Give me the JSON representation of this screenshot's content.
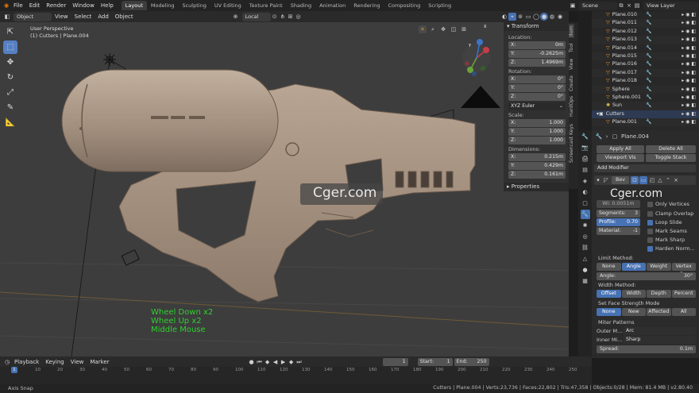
{
  "topbar": {
    "menus": [
      "File",
      "Edit",
      "Render",
      "Window",
      "Help"
    ],
    "workspaces": [
      "Layout",
      "Modeling",
      "Sculpting",
      "UV Editing",
      "Texture Paint",
      "Shading",
      "Animation",
      "Rendering",
      "Compositing",
      "Scripting"
    ],
    "active_workspace": "Layout",
    "scene": "Scene",
    "view_layer": "View Layer"
  },
  "viewport_header": {
    "mode": "Object Mode",
    "menus": [
      "View",
      "Select",
      "Add",
      "Object"
    ],
    "transform_orientation": "Local"
  },
  "viewport": {
    "perspective": "User Perspective",
    "object_info": "(1) Cutters | Plane.004",
    "watermark": "Cger.com",
    "screencast_keys": [
      "Wheel Down x2",
      "Wheel Up x2",
      "Middle Mouse"
    ],
    "gizmo": {
      "x": "X",
      "y": "Y",
      "z": "Z"
    }
  },
  "npanel": {
    "tabs": [
      "Item",
      "Tool",
      "View",
      "Create",
      "HardOps",
      "Screencast Keys"
    ],
    "transform": "Transform",
    "location": {
      "label": "Location:",
      "x": "0m",
      "y": "-0.2625m",
      "z": "1.4969m"
    },
    "rotation": {
      "label": "Rotation:",
      "x": "0°",
      "y": "0°",
      "z": "0°"
    },
    "rotation_mode": "XYZ Euler",
    "scale": {
      "label": "Scale:",
      "x": "1.000",
      "y": "1.000",
      "z": "1.000"
    },
    "dimensions": {
      "label": "Dimensions:",
      "x": "0.215m",
      "y": "0.429m",
      "z": "0.161m"
    },
    "properties": "Properties"
  },
  "outliner": {
    "rows": [
      {
        "name": "Plane.010"
      },
      {
        "name": "Plane.011"
      },
      {
        "name": "Plane.012"
      },
      {
        "name": "Plane.013"
      },
      {
        "name": "Plane.014"
      },
      {
        "name": "Plane.015"
      },
      {
        "name": "Plane.016"
      },
      {
        "name": "Plane.017"
      },
      {
        "name": "Plane.018"
      },
      {
        "name": "Sphere"
      },
      {
        "name": "Sphere.001"
      },
      {
        "name": "Sun"
      },
      {
        "name": "Cutters"
      },
      {
        "name": "Plane.001"
      }
    ]
  },
  "properties": {
    "object_name": "Plane.004",
    "apply_all": "Apply All",
    "delete_all": "Delete All",
    "viewport_vis": "Viewport Vis",
    "toggle_stack": "Toggle Stack",
    "add_modifier": "Add Modifier",
    "modifier_name": "Bev",
    "width_field": "Wi: 0.0051m",
    "only_vertices": "Only Vertices",
    "segments_label": "Segments:",
    "segments": "3",
    "clamp_overlap": "Clamp Overlap",
    "profile_label": "Profile:",
    "profile": "0.70",
    "loop_slide": "Loop Slide",
    "material_label": "Material:",
    "material": "-1",
    "mark_seams": "Mark Seams",
    "mark_sharp": "Mark Sharp",
    "harden_normals": "Harden Norm...",
    "limit_method": "Limit Method:",
    "limit_options": [
      "None",
      "Angle",
      "Weight",
      "Vertex G..."
    ],
    "limit_selected": "Angle",
    "angle_label": "Angle:",
    "angle": "30°",
    "width_method": "Width Method:",
    "width_options": [
      "Offset",
      "Width",
      "Depth",
      "Percent"
    ],
    "width_selected": "Offset",
    "face_strength": "Set Face Strength Mode",
    "face_options": [
      "None",
      "New",
      "Affected",
      "All"
    ],
    "face_selected": "None",
    "miter_patterns": "Miter Patterns",
    "outer_label": "Outer M...",
    "outer_value": "Arc",
    "inner_label": "Inner Mi...",
    "inner_value": "Sharp",
    "spread_label": "Spread:",
    "spread": "0.1m"
  },
  "timeline": {
    "menus": [
      "Playback",
      "Keying",
      "View",
      "Marker"
    ],
    "current_frame": "1",
    "start_label": "Start:",
    "start": "1",
    "end_label": "End:",
    "end": "250",
    "ticks": [
      "0",
      "10",
      "20",
      "30",
      "40",
      "50",
      "60",
      "70",
      "80",
      "90",
      "100",
      "110",
      "120",
      "130",
      "140",
      "150",
      "160",
      "170",
      "180",
      "190",
      "200",
      "210",
      "220",
      "230",
      "240",
      "250"
    ]
  },
  "statusbar": {
    "left": "Axis Snap",
    "right": "Cutters | Plane.004 | Verts:23,736 | Faces:22,802 | Tris:47,358 | Objects:0/28 | Mem: 81.4 MB | v2.80.40"
  },
  "colors": {
    "accent": "#4772b3",
    "model": "#a89482",
    "viewport_bg": "#3d3d3d",
    "screencast": "#2ed12e"
  }
}
